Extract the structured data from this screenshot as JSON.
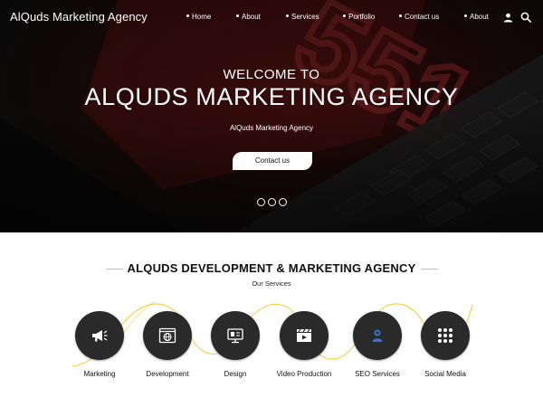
{
  "header": {
    "brand": "AlQuds Marketing Agency",
    "nav": [
      "Home",
      "About",
      "Services",
      "Portfolio",
      "Contact us",
      "About"
    ],
    "icons": [
      "user-icon",
      "search-icon"
    ]
  },
  "hero": {
    "welcome": "WELCOME TO",
    "title": "ALQUDS MARKETING AGENCY",
    "subtitle": "AlQuds Marketing Agency",
    "button": "Contact us",
    "slides": 3,
    "background_glyph": "551"
  },
  "services": {
    "title": "ALQUDS DEVELOPMENT & MARKETING AGENCY",
    "subtitle": "Our Services",
    "accent_color": "#f5c518",
    "items": [
      {
        "label": "Marketing",
        "icon": "megaphone-icon"
      },
      {
        "label": "Development",
        "icon": "web-browser-icon"
      },
      {
        "label": "Design",
        "icon": "design-monitor-icon"
      },
      {
        "label": "Video Production",
        "icon": "clapperboard-icon"
      },
      {
        "label": "SEO Services",
        "icon": "seo-person-icon"
      },
      {
        "label": "Social Media",
        "icon": "social-grid-icon"
      }
    ]
  }
}
